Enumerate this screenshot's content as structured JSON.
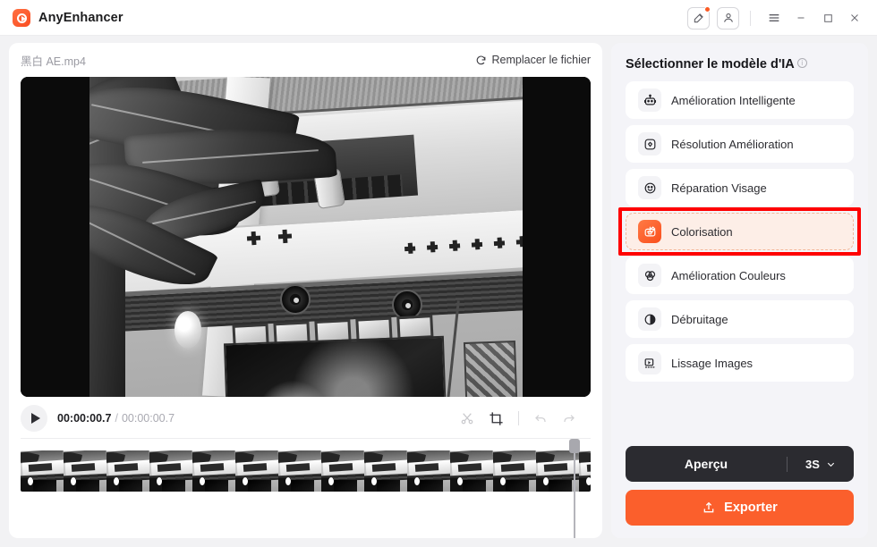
{
  "titlebar": {
    "app_name": "AnyEnhancer",
    "logo_icon": "anyenhancer-logo-icon",
    "feedback_icon": "edit-feedback-icon",
    "account_icon": "user-account-icon",
    "menu_icon": "hamburger-menu-icon",
    "minimize_icon": "minimize-icon",
    "maximize_icon": "maximize-icon",
    "close_icon": "close-icon",
    "notification_badge": true
  },
  "file": {
    "name": "黑白 AE.mp4",
    "replace_label": "Remplacer le fichier",
    "replace_icon": "refresh-icon"
  },
  "player": {
    "play_icon": "play-icon",
    "current_time": "00:00:00.7",
    "separator": "/",
    "total_time": "00:00:00.7",
    "tools": [
      {
        "name": "cut-tool",
        "icon": "scissors-icon",
        "enabled": true
      },
      {
        "name": "crop-tool",
        "icon": "crop-icon",
        "enabled": true
      },
      {
        "name": "undo-tool",
        "icon": "undo-arrow-icon",
        "enabled": false
      },
      {
        "name": "redo-tool",
        "icon": "redo-arrow-icon",
        "enabled": false
      }
    ]
  },
  "timeline": {
    "thumbnail_count": 14,
    "playhead_position_pct": 97
  },
  "ai_panel": {
    "title": "Sélectionner le modèle d'IA",
    "info_icon": "info-icon",
    "info_glyph": "i",
    "models": [
      {
        "label": "Amélioration Intelligente",
        "icon": "robot-icon",
        "selected": false
      },
      {
        "label": "Résolution Amélioration",
        "icon": "resolution-icon",
        "selected": false
      },
      {
        "label": "Réparation Visage",
        "icon": "smiley-face-icon",
        "selected": false
      },
      {
        "label": "Colorisation",
        "icon": "colorize-robot-icon",
        "selected": true
      },
      {
        "label": "Amélioration Couleurs",
        "icon": "color-circles-icon",
        "selected": false
      },
      {
        "label": "Débruitage",
        "icon": "contrast-half-circle-icon",
        "selected": false
      },
      {
        "label": "Lissage Images",
        "icon": "frame-smooth-icon",
        "selected": false
      }
    ]
  },
  "actions": {
    "preview_label": "Aperçu",
    "preview_duration": "3S",
    "preview_chevron_icon": "chevron-down-icon",
    "export_label": "Exporter",
    "export_icon": "upload-icon"
  },
  "colors": {
    "accent_orange": "#fb5f2c",
    "selected_bg": "#fdeee7",
    "selected_border": "#f2b79a",
    "highlight_red": "#ff0000",
    "dark_button": "#2b2b30",
    "panel_bg": "#f4f4f8"
  }
}
